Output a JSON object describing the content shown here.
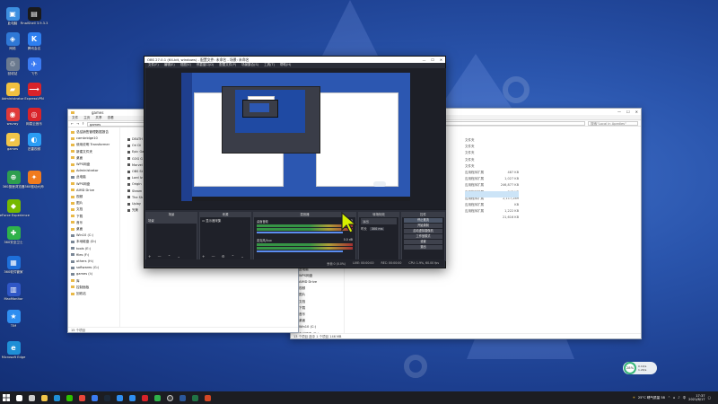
{
  "desktop": {
    "icons": [
      {
        "label": "此电脑",
        "color": "#3d8fe0",
        "glyph": "▣"
      },
      {
        "label": "FinalShell 3.9.3.3",
        "color": "#1a1a1a",
        "glyph": "▤"
      },
      {
        "label": "网络",
        "color": "#2f78d6",
        "glyph": "◈"
      },
      {
        "label": "腾讯会议",
        "color": "#2e7ff0",
        "glyph": "K"
      },
      {
        "label": "回收站",
        "color": "#6b7a8f",
        "glyph": "♲"
      },
      {
        "label": "飞书",
        "color": "#3b7bf2",
        "glyph": "✈"
      },
      {
        "label": "Administrator",
        "color": "#f0c040",
        "glyph": "▰"
      },
      {
        "label": "ExpressVPN",
        "color": "#d8232a",
        "glyph": "⟶"
      },
      {
        "label": "wsvray",
        "color": "#e03a3a",
        "glyph": "◉"
      },
      {
        "label": "网易云音乐",
        "color": "#d8232a",
        "glyph": "◎"
      },
      {
        "label": "games",
        "color": "#f2c54a",
        "glyph": "▰"
      },
      {
        "label": "迅雷视频",
        "color": "#2a9df4",
        "glyph": "◐"
      },
      {
        "label": "360极速浏览器",
        "color": "#2e9e4f",
        "glyph": "⊕"
      },
      {
        "label": "360驱动大师",
        "color": "#f07b1e",
        "glyph": "✦"
      },
      {
        "label": "GeForce Experience",
        "color": "#76b900",
        "glyph": "◆"
      },
      {
        "label": "360安全卫士",
        "color": "#2fb24a",
        "glyph": "✚"
      },
      {
        "label": "360软件管家",
        "color": "#1e6fd9",
        "glyph": "▦"
      },
      {
        "label": "MaxMonitor",
        "color": "#2f56c6",
        "glyph": "▥"
      },
      {
        "label": "TIM",
        "color": "#2f8ef0",
        "glyph": "★"
      },
      {
        "label": "Microsoft Edge",
        "color": "#1f8fd6",
        "glyph": "e"
      }
    ]
  },
  "explorer_left": {
    "title": "games",
    "ribbon": [
      "文件",
      "主页",
      "共享",
      "查看"
    ],
    "path": "games",
    "nav": [
      {
        "label": "总结销售管理数据报告",
        "kind": "folder"
      },
      {
        "label": "cambridge10",
        "kind": "folder"
      },
      {
        "label": "使用说明 Transformer",
        "kind": "folder"
      },
      {
        "label": "新建文件夹",
        "kind": "folder"
      },
      {
        "label": "桌面",
        "kind": "folder"
      },
      {
        "label": "WPS网盘",
        "kind": "folder"
      },
      {
        "label": "Administrator",
        "kind": "folder"
      },
      {
        "label": "此电脑",
        "kind": "drive"
      },
      {
        "label": "WPS网盘",
        "kind": "folder"
      },
      {
        "label": "AIMD Drive",
        "kind": "folder"
      },
      {
        "label": "视频",
        "kind": "folder"
      },
      {
        "label": "图片",
        "kind": "folder"
      },
      {
        "label": "文档",
        "kind": "folder"
      },
      {
        "label": "下载",
        "kind": "folder"
      },
      {
        "label": "音乐",
        "kind": "folder"
      },
      {
        "label": "桌面",
        "kind": "folder"
      },
      {
        "label": "Win10 (C:)",
        "kind": "drive"
      },
      {
        "label": "本地磁盘 (D:)",
        "kind": "drive"
      },
      {
        "label": "tools (E:)",
        "kind": "drive"
      },
      {
        "label": "files (F:)",
        "kind": "drive"
      },
      {
        "label": "others (H:)",
        "kind": "drive"
      },
      {
        "label": "softwares (G:)",
        "kind": "drive"
      },
      {
        "label": "games (I:)",
        "kind": "drive"
      },
      {
        "label": "库",
        "kind": "folder"
      },
      {
        "label": "控制面板",
        "kind": "folder"
      },
      {
        "label": "回收站",
        "kind": "folder"
      }
    ],
    "files": [
      "DEATH",
      "Ori Di",
      "Epic Ga",
      "GOG G",
      "Marvel",
      "OBS St",
      "Lord Iv",
      "Origin",
      "Steam",
      "The Sh",
      "Uplay",
      "完美"
    ],
    "status": "15 个项目"
  },
  "explorer_right": {
    "search_placeholder": "搜索\"Local in Apedies\"",
    "types": [
      "文件夹",
      "文件夹",
      "文件夹",
      "文件夹",
      "文件夹",
      "应用程序扩展",
      "应用程序扩展",
      "应用程序扩展",
      "应用程序扩展",
      "应用程序扩展",
      "应用程序扩展",
      "应用程序扩展"
    ],
    "sizes": [
      "",
      "",
      "",
      "",
      "",
      "487 KB",
      "1,027 KB",
      "246,877 KB",
      "843 KB",
      "2,117,289 KB",
      "1,222 KB",
      "21,616 KB"
    ],
    "nav": [
      "桌面",
      "WPS网盘",
      "Administrator",
      "此电脑",
      "WPS网盘",
      "AIMD Drive",
      "视频",
      "图片",
      "文档",
      "下载",
      "音乐",
      "桌面",
      "Win10 (C:)",
      "本地磁盘 (D:)",
      "tools (E:)",
      "files (F:)",
      "others (H:)",
      "softwares (G:)",
      "games (I:)"
    ],
    "status": "13 个项目  选中 1 个项目  146 MB"
  },
  "obs": {
    "title": "OBS 27.0.1 (64-bit, windows) - 配置文件: 未命名 - 场景: 未命名",
    "menu": [
      "文件(F)",
      "编辑(E)",
      "视图(V)",
      "停靠窗口(D)",
      "配置文件(P)",
      "场景集合(S)",
      "工具(T)",
      "帮助(H)"
    ],
    "docks": {
      "scenes": "场景",
      "scene_item": "场景",
      "sources": "来源",
      "source_item": "显示器采集",
      "mixer": "混音器",
      "mixer_tracks": [
        {
          "name": "桌面音频",
          "level": "0.0 dB"
        },
        {
          "name": "麦克风/Aux",
          "level": "0.0 dB"
        }
      ],
      "transitions": "转场特效",
      "transition_type": "淡出",
      "duration_label": "时长",
      "duration_value": "300 ms",
      "controls": "控件",
      "control_buttons": [
        "停止推流",
        "开始录制",
        "启动虚拟摄像机",
        "工作室模式",
        "设置",
        "退出"
      ]
    },
    "status": [
      "丢帧 0 (0.0%)",
      "LIVE: 00:00:00",
      "REC: 00:00:00",
      "CPU: 1.9%, 60.00 fps"
    ]
  },
  "net_widget": {
    "percent": "28%",
    "up": "0.1K/s",
    "down": "1.2K/s"
  },
  "taskbar": {
    "apps": [
      {
        "name": "search",
        "color": "#ffffff"
      },
      {
        "name": "task-view",
        "color": "#cccccc"
      },
      {
        "name": "explorer",
        "color": "#f2c54a"
      },
      {
        "name": "edge",
        "color": "#1f8fd6"
      },
      {
        "name": "wechat",
        "color": "#2dc100"
      },
      {
        "name": "chrome",
        "color": "#e9463a"
      },
      {
        "name": "feishu",
        "color": "#3b7bf2"
      },
      {
        "name": "steam",
        "color": "#1b2838"
      },
      {
        "name": "qq",
        "color": "#2f8ef0"
      },
      {
        "name": "tim",
        "color": "#2f8ef0"
      },
      {
        "name": "netease-music",
        "color": "#d8232a"
      },
      {
        "name": "360",
        "color": "#2fb24a"
      },
      {
        "name": "obs",
        "color": "#444444"
      },
      {
        "name": "word",
        "color": "#2b579a"
      },
      {
        "name": "excel",
        "color": "#217346"
      },
      {
        "name": "powerpoint",
        "color": "#d24726"
      }
    ],
    "weather": "25°C 晴气质量 58",
    "time": "17:37",
    "date": "2021/8/17"
  }
}
